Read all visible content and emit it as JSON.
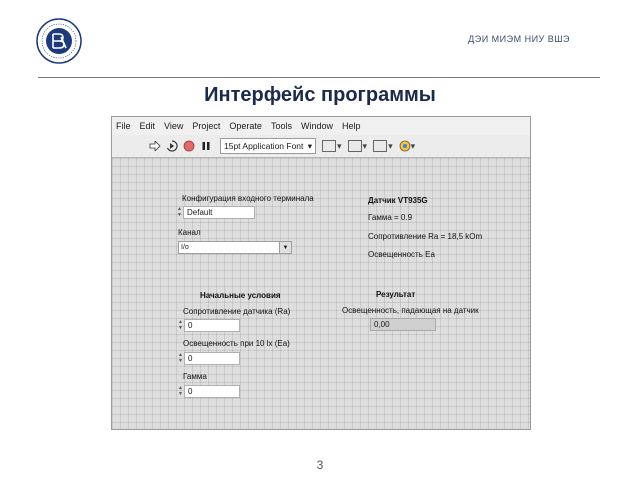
{
  "header": {
    "organization": "ДЭИ МИЭМ НИУ ВШЭ",
    "logo_name": "hse-logo"
  },
  "slide": {
    "title": "Интерфейс программы",
    "page_number": "3"
  },
  "labview": {
    "menu": [
      "File",
      "Edit",
      "View",
      "Project",
      "Operate",
      "Tools",
      "Window",
      "Help"
    ],
    "toolbar": {
      "font": "15pt Application Font",
      "icons": [
        "run-arrow-icon",
        "run-continuous-icon",
        "abort-icon",
        "pause-icon",
        "align-icon",
        "distribute-icon",
        "resize-icon",
        "reorder-icon"
      ]
    },
    "input_config": {
      "label": "Конфигурация входного терминала",
      "value": "Default"
    },
    "channel": {
      "label": "Канал",
      "value": ""
    },
    "sensor": {
      "title": "Датчик VT935G",
      "gamma": "Гамма = 0.9",
      "resistance": "Сопротивление Ra = 18,5 kOm",
      "illuminance": "Освещенность Ea"
    },
    "initial": {
      "title": "Начальные условия",
      "fields": [
        {
          "label": "Сопротивление датчика (Ra)",
          "value": "0"
        },
        {
          "label": "Освещенность при 10 lx (Ea)",
          "value": "0"
        },
        {
          "label": "Гамма",
          "value": "0"
        }
      ]
    },
    "result": {
      "title": "Результат",
      "label": "Освещенность, падающая на датчик",
      "value": "0,00"
    }
  }
}
